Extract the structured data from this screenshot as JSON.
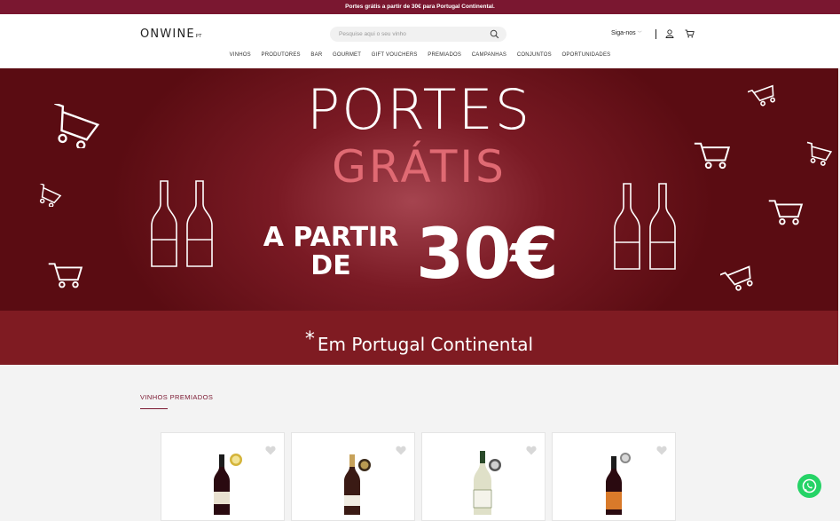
{
  "promo_bar": {
    "text": "Portes grátis a partir de 30€ para Portugal Continental."
  },
  "header": {
    "logo_main": "ONWINE",
    "logo_suffix": "PT",
    "search_placeholder": "Pesquise aqui o seu vinho",
    "follow_label": "Siga-nos"
  },
  "nav": {
    "items": [
      "VINHOS",
      "PRODUTORES",
      "BAR",
      "GOURMET",
      "GIFT VOUCHERS",
      "PREMIADOS",
      "CAMPANHAS",
      "CONJUNTOS",
      "OPORTUNIDADES"
    ]
  },
  "hero": {
    "line1": "PORTES",
    "line2": "GRÁTIS",
    "line3a": "A PARTIR",
    "line3b": "DE",
    "line4": "30€",
    "footnote_mark": "*",
    "footnote": "Em Portugal Continental"
  },
  "section": {
    "title": "VINHOS PREMIADOS"
  },
  "colors": {
    "brand": "#7a1730",
    "hero_dark": "#5a0c12",
    "hero_accent": "#e06a73",
    "whatsapp": "#25d366"
  },
  "icons": [
    "search-icon",
    "chevron-down-icon",
    "user-icon",
    "cart-icon",
    "heart-icon",
    "whatsapp-icon"
  ]
}
